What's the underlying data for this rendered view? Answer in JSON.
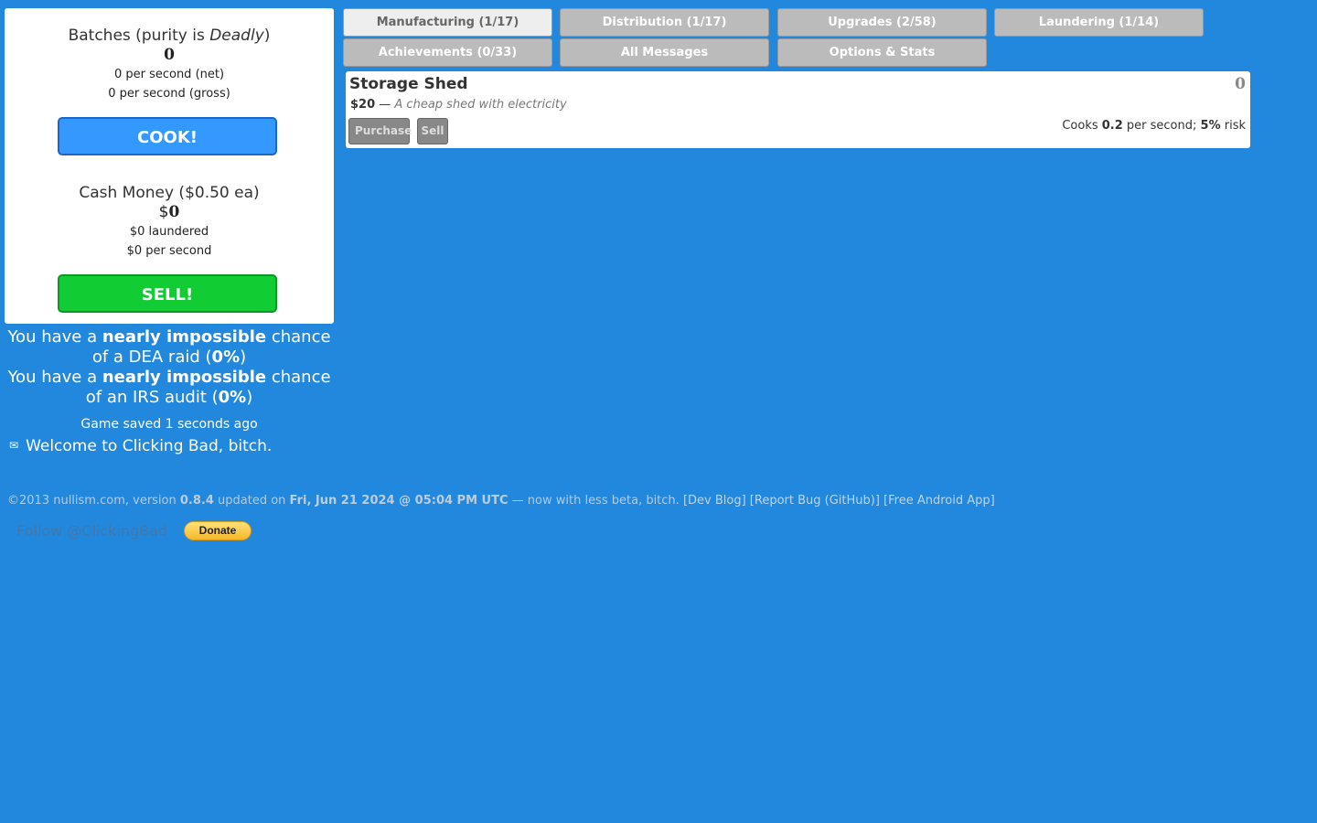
{
  "batches": {
    "title_prefix": "Batches (purity is ",
    "purity": "Deadly",
    "title_suffix": ")",
    "count": "0",
    "net_rate": "0 per second (net)",
    "gross_rate": "0 per second (gross)"
  },
  "cook_button": "COOK!",
  "cash": {
    "title": "Cash Money ($0.50 ea)",
    "symbol": "$",
    "amount": "0",
    "laundered": "$0 laundered",
    "rate": "$0 per second"
  },
  "sell_button": "SELL!",
  "risk": {
    "dea_prefix": "You have a ",
    "dea_level": "nearly impossible",
    "dea_middle": " chance of a DEA raid (",
    "dea_percent": "0%",
    "dea_suffix": ")",
    "irs_prefix": "You have a ",
    "irs_level": "nearly impossible",
    "irs_middle": " chance of an IRS audit (",
    "irs_percent": "0%",
    "irs_suffix": ")"
  },
  "saved_text": "Game saved 1 seconds ago",
  "message": {
    "icon": "envelope-icon",
    "text": "Welcome to Clicking Bad, bitch."
  },
  "tabs": [
    {
      "label": "Manufacturing (1/17)",
      "active": true
    },
    {
      "label": "Distribution (1/17)",
      "active": false
    },
    {
      "label": "Upgrades (2/58)",
      "active": false
    },
    {
      "label": "Laundering (1/14)",
      "active": false
    },
    {
      "label": "Achievements (0/33)",
      "active": false
    },
    {
      "label": "All Messages",
      "active": false
    },
    {
      "label": "Options & Stats",
      "active": false
    }
  ],
  "item": {
    "name": "Storage Shed",
    "count": "0",
    "price": "$20",
    "dash": " — ",
    "description": "A cheap shed with electricity",
    "purchase_label": "Purchase",
    "sell_label": "Sell",
    "stats_prefix": "Cooks ",
    "stats_rate": "0.2",
    "stats_middle": " per second; ",
    "stats_risk": "5%",
    "stats_suffix": " risk"
  },
  "footer": {
    "copyright": "©2013 nullism.com, version ",
    "version": "0.8.4",
    "updated_on": " updated on ",
    "date": "Fri, Jun 21 2024 @ 05:04 PM UTC",
    "tagline": " — now with less beta, bitch. ",
    "dev_blog": "[Dev Blog]",
    "report_bug": "[Report Bug (GitHub)]",
    "android_app": "[Free Android App]",
    "follow": "Follow @ClickingBad",
    "donate": "Donate"
  },
  "colors": {
    "background": "#2288dd",
    "cook_button": "#3399ff",
    "sell_button": "#11cc33",
    "tab_inactive": "#bbbbbb",
    "tab_active": "#eeeeee"
  }
}
